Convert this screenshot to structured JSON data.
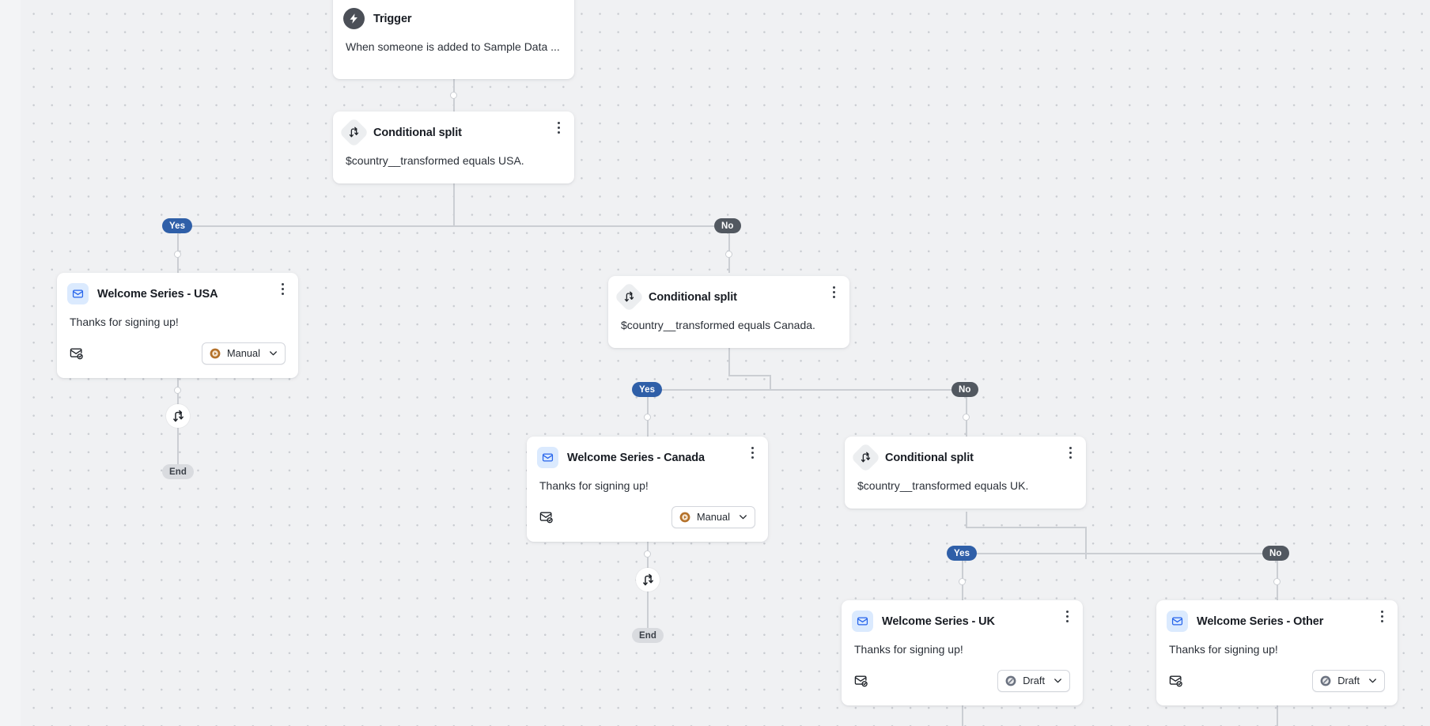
{
  "canvas": {
    "background_color": "#f0f1f3",
    "dot_color": "#c9ccd1"
  },
  "colors": {
    "yes_pill": "#2f5fa8",
    "no_pill": "#525860",
    "end_pill": "#d9dbdf",
    "edge": "#cbced3",
    "trigger_icon_bg": "#4b4f57",
    "email_icon_bg": "#dbeafe",
    "email_icon_fg": "#2563eb",
    "split_icon_bg": "#eceef0",
    "manual_accent": "#b4712a",
    "draft_accent": "#6b7280",
    "card_bg": "#ffffff",
    "title_text": "#181c23",
    "body_text": "#2b3038"
  },
  "nodes": {
    "trigger": {
      "icon": "lightning-bolt-icon",
      "title": "Trigger",
      "body": "When someone is added to Sample Data ..."
    },
    "split_usa": {
      "icon": "conditional-split-icon",
      "title": "Conditional split",
      "body": "$country__transformed equals USA.",
      "menu": "kebab-menu-icon"
    },
    "split_canada": {
      "icon": "conditional-split-icon",
      "title": "Conditional split",
      "body": "$country__transformed equals Canada.",
      "menu": "kebab-menu-icon"
    },
    "split_uk": {
      "icon": "conditional-split-icon",
      "title": "Conditional split",
      "body": "$country__transformed equals UK.",
      "menu": "kebab-menu-icon"
    },
    "email_usa": {
      "icon": "email-icon",
      "title": "Welcome Series - USA",
      "body": "Thanks for signing up!",
      "footer_icon": "email-check-icon",
      "status": "Manual",
      "status_icon": "manual-status-icon",
      "chevron": "chevron-down-icon",
      "menu": "kebab-menu-icon"
    },
    "email_canada": {
      "icon": "email-icon",
      "title": "Welcome Series - Canada",
      "body": "Thanks for signing up!",
      "footer_icon": "email-check-icon",
      "status": "Manual",
      "status_icon": "manual-status-icon",
      "chevron": "chevron-down-icon",
      "menu": "kebab-menu-icon"
    },
    "email_uk": {
      "icon": "email-icon",
      "title": "Welcome Series - UK",
      "body": "Thanks for signing up!",
      "footer_icon": "email-check-icon",
      "status": "Draft",
      "status_icon": "draft-status-icon",
      "chevron": "chevron-down-icon",
      "menu": "kebab-menu-icon"
    },
    "email_other": {
      "icon": "email-icon",
      "title": "Welcome Series - Other",
      "body": "Thanks for signing up!",
      "footer_icon": "email-check-icon",
      "status": "Draft",
      "status_icon": "draft-status-icon",
      "chevron": "chevron-down-icon",
      "menu": "kebab-menu-icon"
    }
  },
  "edges": {
    "branch_usa_yes": "Yes",
    "branch_usa_no": "No",
    "branch_canada_yes": "Yes",
    "branch_canada_no": "No",
    "branch_uk_yes": "Yes",
    "branch_uk_no": "No"
  },
  "terminators": {
    "end_usa": "End",
    "end_canada": "End"
  },
  "status_options": [
    "Manual",
    "Draft"
  ]
}
